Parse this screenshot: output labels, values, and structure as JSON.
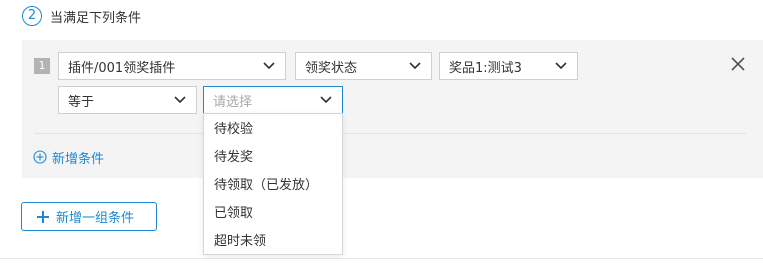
{
  "step": {
    "number": "2",
    "title": "当满足下列条件"
  },
  "condition": {
    "row_number": "1",
    "plugin_select": "插件/001领奖插件",
    "field_select": "领奖状态",
    "prize_select": "奖品1:测试3",
    "operator_select": "等于",
    "value_select_placeholder": "请选择"
  },
  "dropdown": {
    "options": [
      "待校验",
      "待发奖",
      "待领取（已发放）",
      "已领取",
      "超时未领"
    ]
  },
  "actions": {
    "add_condition": "新增条件",
    "add_group": "新增一组条件"
  },
  "colors": {
    "accent": "#1e88d6",
    "panel_bg": "#f4f4f4"
  }
}
